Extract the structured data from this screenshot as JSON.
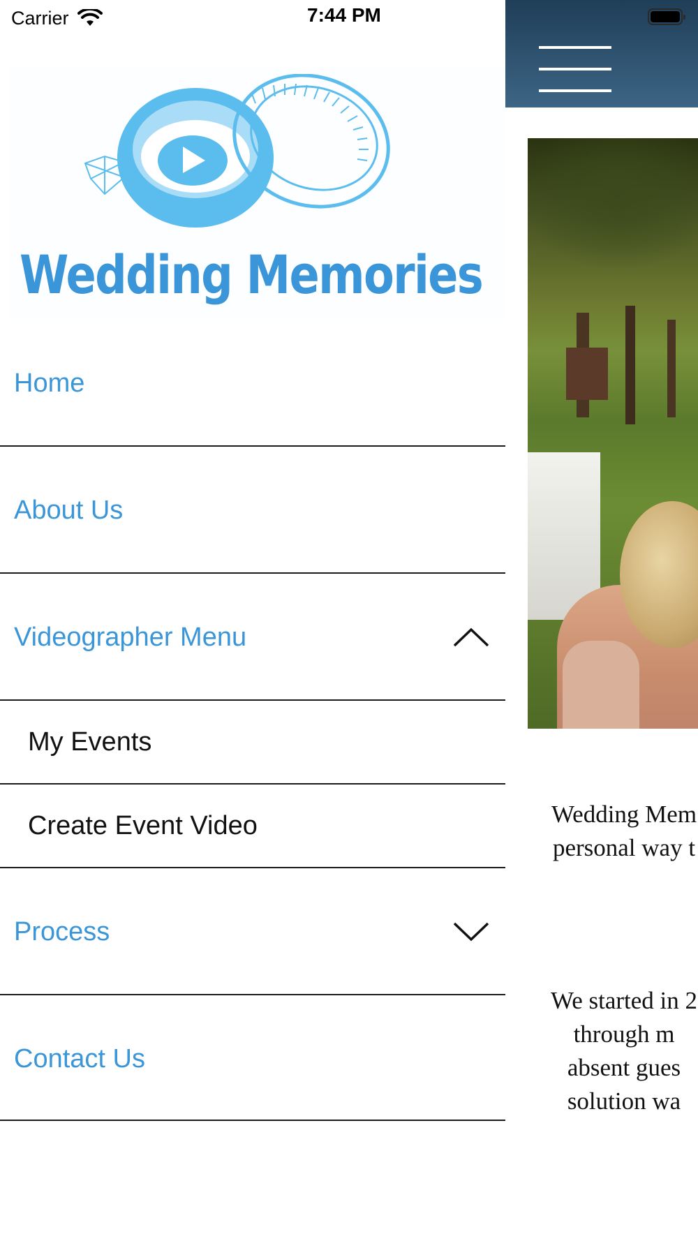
{
  "status_bar": {
    "carrier": "Carrier",
    "time": "7:44 PM"
  },
  "drawer": {
    "logo_text": "Wedding Memories",
    "menu": [
      {
        "label": "Home"
      },
      {
        "label": "About Us"
      },
      {
        "label": "Videographer Menu",
        "expanded": true,
        "icon": "chevron-up-icon"
      },
      {
        "label": "My Events",
        "submenu": true
      },
      {
        "label": "Create Event Video",
        "submenu": true
      },
      {
        "label": "Process",
        "expanded": false,
        "icon": "chevron-down-icon"
      },
      {
        "label": "Contact Us"
      }
    ]
  },
  "page": {
    "paragraph1": [
      "Wedding Mem",
      "personal way t"
    ],
    "paragraph2": [
      "We started in 2",
      "through m",
      "absent gues",
      "solution wa"
    ]
  },
  "colors": {
    "accent": "#3a96d8",
    "logo_light": "#5bbcee",
    "header_dark": "#1f3e58",
    "header_light": "#3d6585"
  }
}
